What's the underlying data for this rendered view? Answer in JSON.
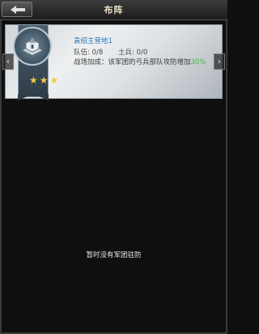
{
  "header": {
    "title": "布阵",
    "back_icon": "back-arrow-icon"
  },
  "camp": {
    "name": "袁绍主营地1",
    "troops_label": "队伍:",
    "troops_value": "0/8",
    "soldiers_label": "士兵:",
    "soldiers_value": "0/0",
    "bonus_prefix": "战场加成：该军团的弓兵部队攻防增加",
    "bonus_value": "30",
    "bonus_suffix": "%",
    "stars": 3
  },
  "nav": {
    "prev_icon": "chevron-left-icon",
    "next_icon": "chevron-right-icon"
  },
  "empty_message": "暂时没有军团驻防",
  "colors": {
    "name": "#2d74b8",
    "bonus_highlight": "#41b43a",
    "star": "#f5c744"
  }
}
